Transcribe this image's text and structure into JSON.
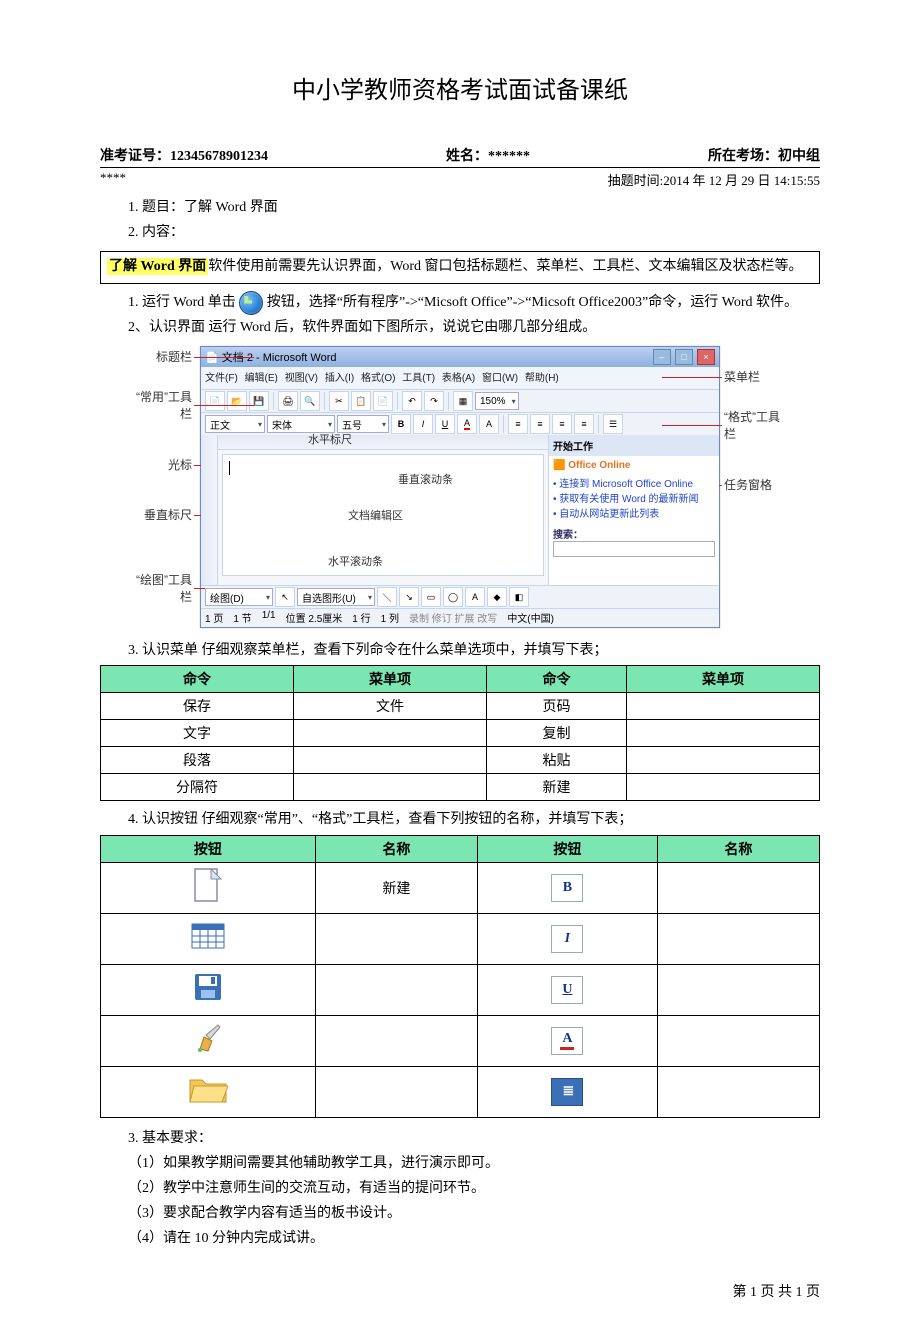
{
  "title": "中小学教师资格考试面试备课纸",
  "header": {
    "exam_id_label": "准考证号：",
    "exam_id": "12345678901234",
    "name_label": "姓名：",
    "name": "******",
    "room_label": "所在考场：",
    "room": "初中组",
    "asterisks": "****",
    "draw_time_label": "抽题时间:",
    "draw_time": "2014 年 12 月 29 日 14:15:55"
  },
  "q1_label": "1. 题目：",
  "q1_value": "了解 Word 界面",
  "q2_label": "2. 内容：",
  "highlight": {
    "topic": "了解 Word 界面",
    "rest": "软件使用前需要先认识界面，Word 窗口包括标题栏、菜单栏、工具栏、文本编辑区及状态栏等。"
  },
  "p_run_1": "1. 运行 Word 单击",
  "p_run_2": "按钮，选择“所有程序”->“Micsoft Office”->“Micsoft Office2003”命令，运行 Word 软件。",
  "p_ui": "2、认识界面 运行 Word 后，软件界面如下图所示，说说它由哪几部分组成。",
  "word": {
    "title": "文档 2 - Microsoft Word",
    "menus": [
      "文件(F)",
      "编辑(E)",
      "视图(V)",
      "插入(I)",
      "格式(O)",
      "工具(T)",
      "表格(A)",
      "窗口(W)",
      "帮助(H)"
    ],
    "zoom": "150%",
    "style": "正文",
    "font": "宋体",
    "size": "五号",
    "taskpane_title": "开始工作",
    "taskpane_brand": "Office Online",
    "taskpane_l1": "连接到 Microsoft Office Online",
    "taskpane_l2": "获取有关使用 Word 的最新新闻",
    "taskpane_l3": "自动从网站更新此列表",
    "taskpane_search": "搜索：",
    "status": [
      "1 页",
      "1 节",
      "1/1",
      "位置 2.5厘米",
      "1 行",
      "1 列",
      "录制 修订 扩展 改写",
      "中文(中国)"
    ],
    "labels": {
      "titlebar": "标题栏",
      "menubar": "菜单栏",
      "std_toolbar": "“常用”工具栏",
      "fmt_toolbar": "“格式”工具栏",
      "cursor": "光标",
      "hruler": "水平标尺",
      "vruler": "垂直标尺",
      "vscroll": "垂直滚动条",
      "editarea": "文档编辑区",
      "hscroll": "水平滚动条",
      "taskpane": "任务窗格",
      "draw_toolbar": "“绘图”工具栏"
    }
  },
  "p_menu": "3. 认识菜单 仔细观察菜单栏，查看下列命令在什么菜单选项中，并填写下表；",
  "table_menu": {
    "headers": [
      "命令",
      "菜单项",
      "命令",
      "菜单项"
    ],
    "rows": [
      [
        "保存",
        "文件",
        "页码",
        ""
      ],
      [
        "文字",
        "",
        "复制",
        ""
      ],
      [
        "段落",
        "",
        "粘贴",
        ""
      ],
      [
        "分隔符",
        "",
        "新建",
        ""
      ]
    ]
  },
  "p_btn": "4. 认识按钮 仔细观察“常用”、“格式”工具栏，查看下列按钮的名称，并填写下表；",
  "table_btn": {
    "headers": [
      "按钮",
      "名称",
      "按钮",
      "名称"
    ],
    "rows": [
      {
        "left_icon": "newdoc",
        "left_name": "新建",
        "right_icon": "bold",
        "right_name": ""
      },
      {
        "left_icon": "table",
        "left_name": "",
        "right_icon": "italic",
        "right_name": ""
      },
      {
        "left_icon": "save",
        "left_name": "",
        "right_icon": "underline",
        "right_name": ""
      },
      {
        "left_icon": "brush",
        "left_name": "",
        "right_icon": "fontcolor",
        "right_name": ""
      },
      {
        "left_icon": "folder",
        "left_name": "",
        "right_icon": "align",
        "right_name": ""
      }
    ]
  },
  "req_title": "3. 基本要求：",
  "reqs": [
    "（1）如果教学期间需要其他辅助教学工具，进行演示即可。",
    "（2）教学中注意师生间的交流互动，有适当的提问环节。",
    "（3）要求配合教学内容有适当的板书设计。",
    "（4）请在 10 分钟内完成试讲。"
  ],
  "footer": "第 1 页 共 1 页"
}
